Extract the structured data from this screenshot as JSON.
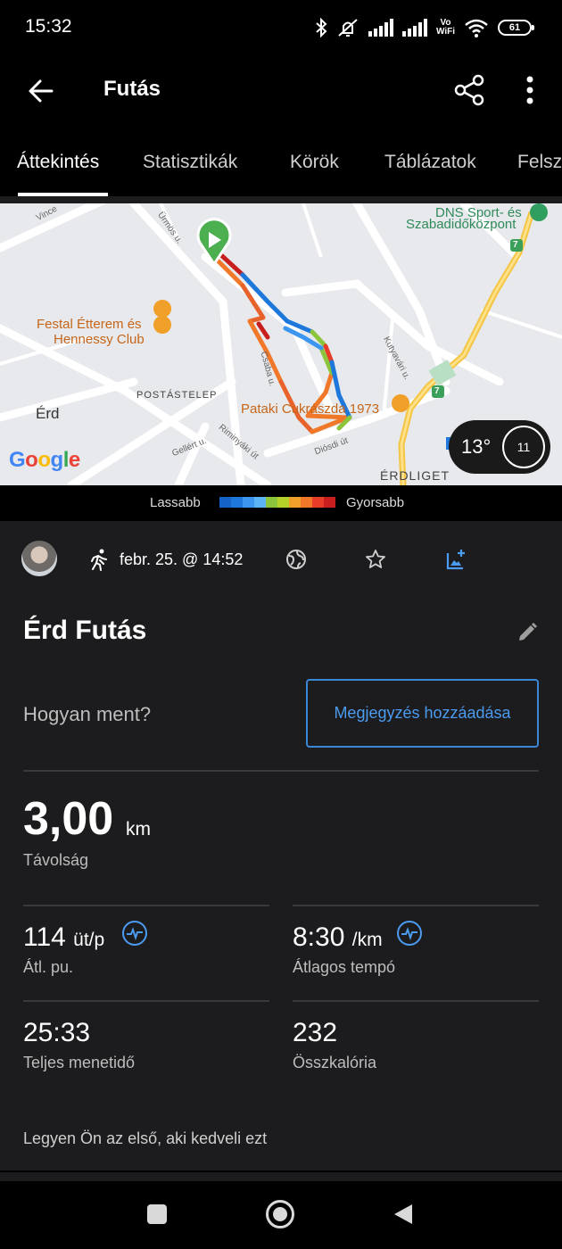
{
  "status_bar": {
    "time": "15:32",
    "icons": [
      "bluetooth-icon",
      "mute-vibrate-icon",
      "signal-icon",
      "signal-icon",
      "vowifi-icon",
      "wifi-icon",
      "battery-icon"
    ],
    "vowifi_top": "Vo",
    "vowifi_bottom": "WiFi",
    "battery": "61"
  },
  "app_bar": {
    "title": "Futás",
    "icons": [
      "back-arrow-icon",
      "share-icon",
      "more-vertical-icon"
    ]
  },
  "tabs": [
    "Áttekintés",
    "Statisztikák",
    "Körök",
    "Táblázatok",
    "Felsz"
  ],
  "map": {
    "labels": {
      "vince": "Vince",
      "urmos": "Ürmös u.",
      "dns_line1": "DNS Sport- és",
      "dns_line2": "Szabadidőközpont",
      "festal_line1": "Festal Étterem és",
      "festal_line2": "Hennessy Club",
      "kutyavari": "Kutyavári u.",
      "postastelep": "POSTÁSTELEP",
      "csaba": "Csaba u.",
      "erd": "Érd",
      "pataki": "Pataki Cukrászda 1973",
      "gellert": "Gellért u.",
      "riminyaki": "Riminyáki út",
      "diosdi": "Diósdi út",
      "erdliget": "ÉRDLIGET",
      "road_7a": "7",
      "road_7b": "7"
    },
    "google_logo": "Google",
    "weather": {
      "temp": "13°",
      "wind": "11"
    }
  },
  "legend": {
    "slower": "Lassabb",
    "faster": "Gyorsabb",
    "colors": [
      "#1464c8",
      "#1e78dc",
      "#3c96f0",
      "#5cb4f5",
      "#8cc43c",
      "#b4d228",
      "#f0a028",
      "#f07828",
      "#e63c28",
      "#c81e1e"
    ]
  },
  "activity": {
    "date": "febr. 25. @ 14:52",
    "title": "Érd Futás",
    "how_question": "Hogyan ment?",
    "add_note_button": "Megjegyzés hozzáadása",
    "distance": {
      "value": "3,00",
      "unit": "km",
      "label": "Távolság"
    },
    "heart_rate": {
      "value": "114",
      "unit": "üt/p",
      "label": "Átl. pu."
    },
    "pace": {
      "value": "8:30",
      "unit": "/km",
      "label": "Átlagos tempó"
    },
    "total_time": {
      "value": "25:33",
      "label": "Teljes menetidő"
    },
    "calories": {
      "value": "232",
      "label": "Összkalória"
    },
    "likes_text": "Legyen Ön az első, aki kedveli ezt"
  },
  "colors": {
    "accent": "#4b9bf0",
    "card_bg": "#1c1c1e",
    "start_marker": "#4caf50"
  }
}
